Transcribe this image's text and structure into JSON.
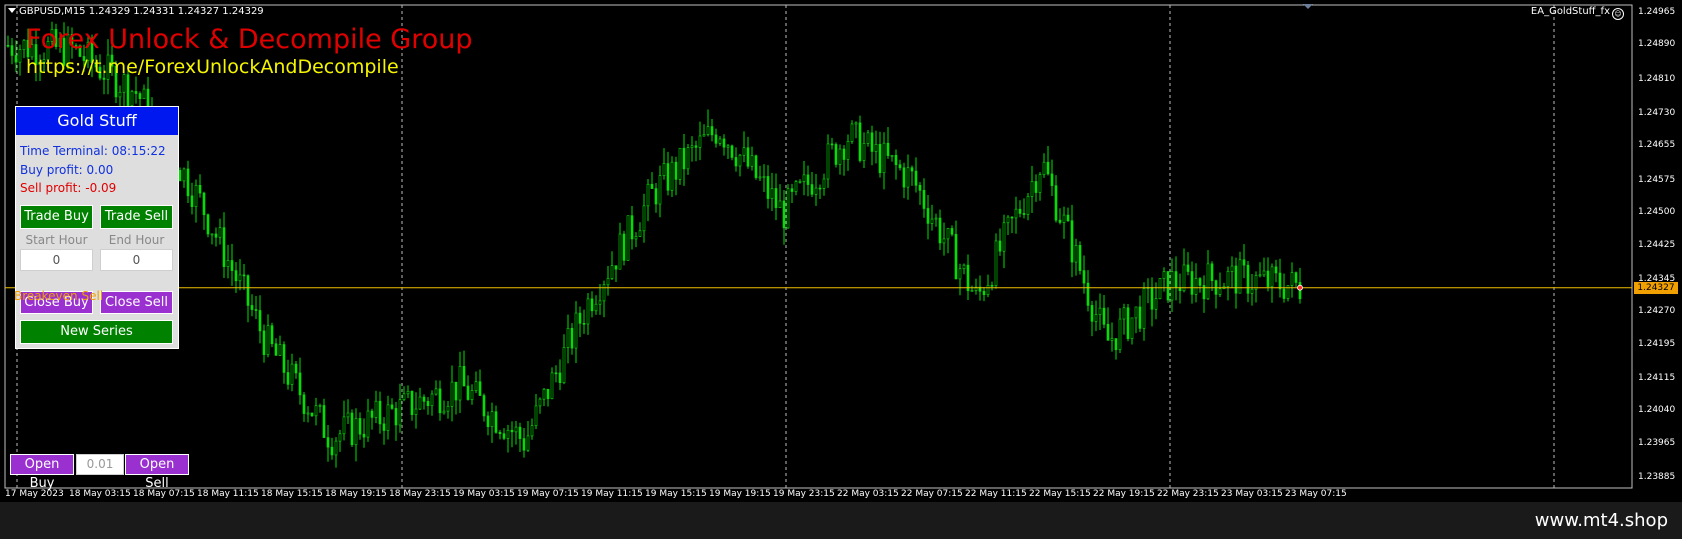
{
  "symbol_header": "GBPUSD,M15  1.24329 1.24331 1.24327 1.24329",
  "ea_label": "EA_GoldStuff_fx",
  "brand": {
    "title": "Forex Unlock & Decompile Group",
    "link": "https://t.me/ForexUnlockAndDecompile"
  },
  "colors": {
    "background": "#000000",
    "candles": "#00e000",
    "price_line": "#f0c000",
    "panel_title": "#0018f0",
    "buy_profit": "#1030e0",
    "sell_profit": "#e00000",
    "btn_green": "#008200",
    "btn_purple": "#9a30d0"
  },
  "price_axis": {
    "ticks": [
      "1.24965",
      "1.24890",
      "1.24810",
      "1.24730",
      "1.24655",
      "1.24575",
      "1.24500",
      "1.24425",
      "1.24345",
      "1.24270",
      "1.24195",
      "1.24115",
      "1.24040",
      "1.23965",
      "1.23885"
    ],
    "current_price": "1.24327"
  },
  "time_axis": {
    "ticks": [
      "17 May 2023",
      "18 May 03:15",
      "18 May 07:15",
      "18 May 11:15",
      "18 May 15:15",
      "18 May 19:15",
      "18 May 23:15",
      "19 May 03:15",
      "19 May 07:15",
      "19 May 11:15",
      "19 May 15:15",
      "19 May 19:15",
      "19 May 23:15",
      "22 May 03:15",
      "22 May 07:15",
      "22 May 11:15",
      "22 May 15:15",
      "22 May 19:15",
      "22 May 23:15",
      "23 May 03:15",
      "23 May 07:15"
    ]
  },
  "panel": {
    "title": "Gold Stuff",
    "time_terminal": "Time Terminal: 08:15:22",
    "buy_profit": "Buy profit: 0.00",
    "sell_profit": "Sell profit: -0.09",
    "trade_buy": "Trade Buy",
    "trade_sell": "Trade Sell",
    "start_hour_label": "Start Hour",
    "end_hour_label": "End Hour",
    "start_hour_value": "0",
    "end_hour_value": "0",
    "breakeven_text": "Breakeven Sell",
    "close_buy": "Close Buy",
    "close_sell": "Close Sell",
    "new_series": "New Series"
  },
  "order_bar": {
    "open_buy": "Open Buy",
    "lot_value": "0.01",
    "open_sell": "Open Sell"
  },
  "footer_site": "www.mt4.shop",
  "chart_data": {
    "type": "candlestick",
    "symbol": "GBPUSD",
    "timeframe": "M15",
    "ylim": [
      1.2385,
      1.2497
    ],
    "current_price": 1.24327,
    "x": [
      "17 May 2023",
      "18 May 03:15",
      "18 May 07:15",
      "18 May 11:15",
      "18 May 15:15",
      "18 May 19:15",
      "18 May 23:15",
      "19 May 03:15",
      "19 May 07:15",
      "19 May 11:15",
      "19 May 15:15",
      "19 May 19:15",
      "19 May 23:15",
      "22 May 03:15",
      "22 May 07:15",
      "22 May 11:15",
      "22 May 15:15",
      "22 May 19:15",
      "22 May 23:15",
      "23 May 03:15",
      "23 May 07:15"
    ],
    "close_approx": [
      1.2489,
      1.2488,
      1.2478,
      1.2452,
      1.242,
      1.2398,
      1.2404,
      1.241,
      1.2397,
      1.243,
      1.2455,
      1.247,
      1.245,
      1.2468,
      1.2458,
      1.243,
      1.2462,
      1.242,
      1.2434,
      1.2435,
      1.2433
    ]
  }
}
